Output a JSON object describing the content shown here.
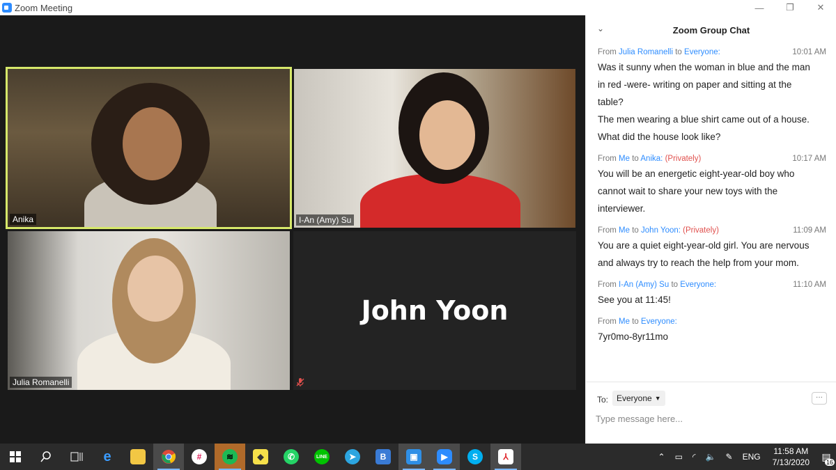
{
  "window": {
    "title": "Zoom Meeting",
    "minimize": "—",
    "restore": "❐",
    "close": "✕"
  },
  "participants": {
    "anika": "Anika",
    "amy": "I-An (Amy) Su",
    "julia": "Julia Romanelli",
    "john": "John Yoon"
  },
  "chat": {
    "title": "Zoom Group Chat",
    "messages": [
      {
        "from_prefix": "From",
        "sender": "Julia Romanelli",
        "to_word": "to",
        "recipient": "Everyone:",
        "privately": "",
        "time": "10:01 AM",
        "lines": [
          "Was it sunny when the woman in blue and the man",
          "in red -were- writing on paper and sitting at the",
          "table?",
          "The men wearing a blue shirt came out of a house.",
          "What did the house look like?"
        ]
      },
      {
        "from_prefix": "From",
        "sender": "Me",
        "to_word": "to",
        "recipient": "Anika:",
        "privately": "(Privately)",
        "time": "10:17 AM",
        "lines": [
          "You will be an energetic eight-year-old boy who",
          "cannot wait to share your new toys with the",
          "interviewer."
        ]
      },
      {
        "from_prefix": "From",
        "sender": "Me",
        "to_word": "to",
        "recipient": "John Yoon:",
        "privately": "(Privately)",
        "time": "11:09 AM",
        "lines": [
          "You are a quiet eight-year-old girl. You are nervous",
          "and always try to reach the help from your mom."
        ]
      },
      {
        "from_prefix": "From",
        "sender": "I-An (Amy) Su",
        "to_word": "to",
        "recipient": "Everyone:",
        "privately": "",
        "time": "11:10 AM",
        "lines": [
          "See you at 11:45!"
        ]
      },
      {
        "from_prefix": "From",
        "sender": "Me",
        "to_word": "to",
        "recipient": "Everyone:",
        "privately": "",
        "time": "",
        "lines": [
          "7yr0mo-8yr11mo"
        ]
      }
    ],
    "to_label": "To:",
    "to_value": "Everyone",
    "more_label": "···",
    "input_placeholder": "Type message here..."
  },
  "taskbar": {
    "tray_language": "ENG",
    "clock_time": "11:58 AM",
    "clock_date": "7/13/2020",
    "notification_count": "16"
  }
}
